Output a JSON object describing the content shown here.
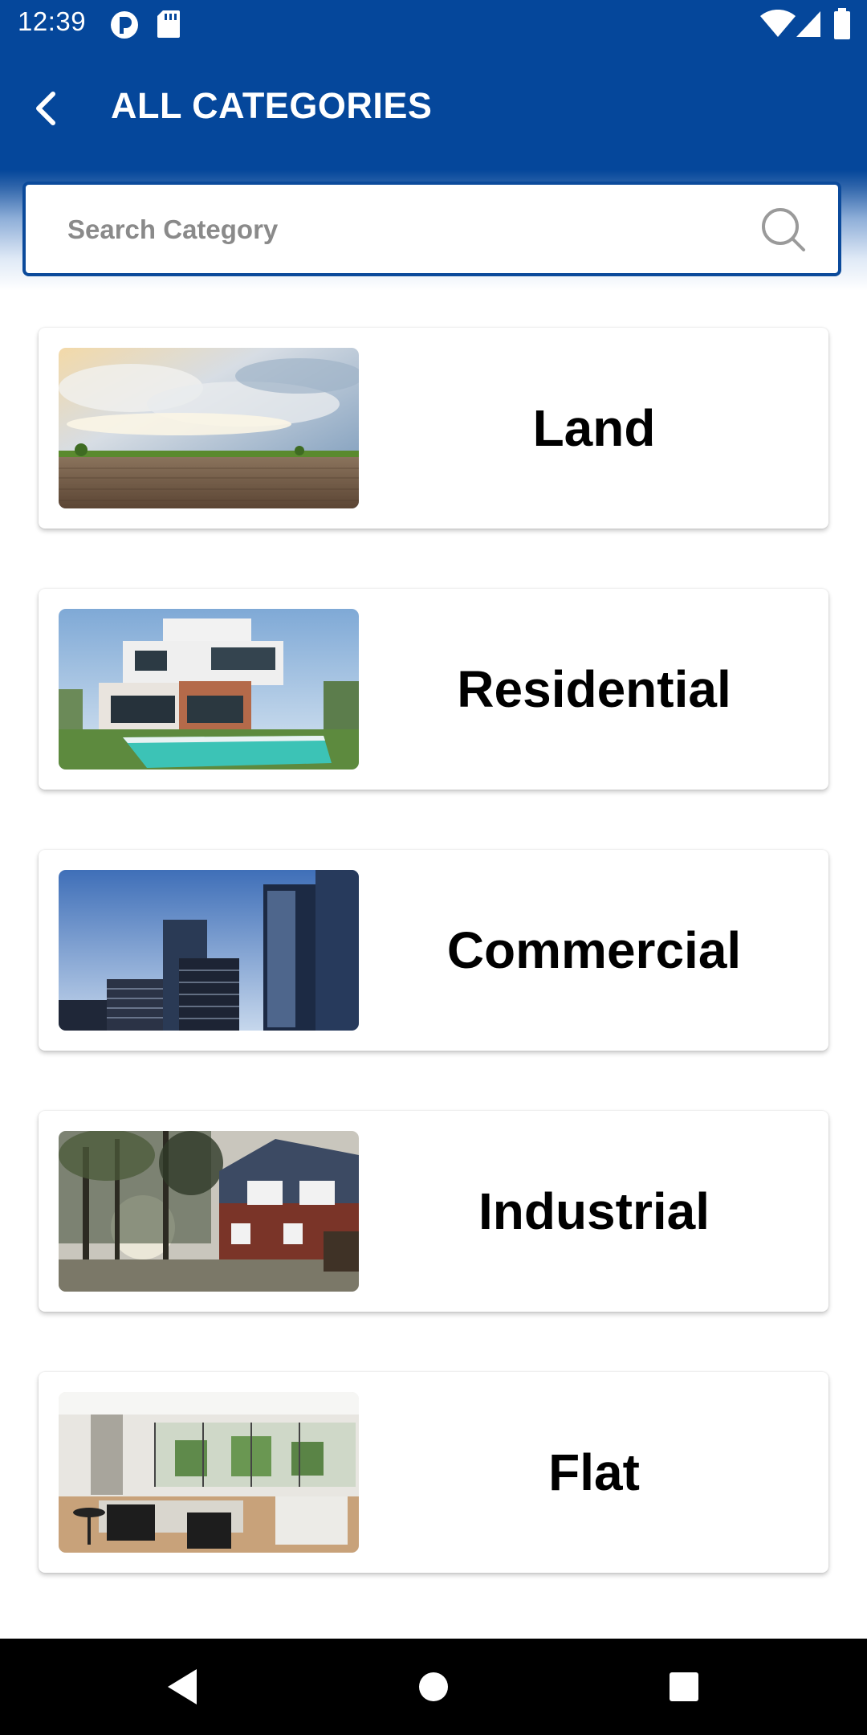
{
  "status_bar": {
    "time": "12:39",
    "icons": [
      "tracker-icon",
      "sd-card-icon",
      "wifi-icon",
      "cell-signal-icon",
      "battery-icon"
    ]
  },
  "app_bar": {
    "back_icon": "chevron-left-icon",
    "title": "ALL CATEGORIES",
    "background_color": "#05479b"
  },
  "search": {
    "placeholder": "Search Category",
    "value": "",
    "icon": "search-icon",
    "border_color": "#0b4a9b"
  },
  "categories": [
    {
      "label": "Land",
      "image": "farmland-photo"
    },
    {
      "label": "Residential",
      "image": "modern-villa-photo"
    },
    {
      "label": "Commercial",
      "image": "skyscrapers-photo"
    },
    {
      "label": "Industrial",
      "image": "brick-house-photo"
    },
    {
      "label": "Flat",
      "image": "living-room-photo"
    }
  ],
  "nav_bar": {
    "icons": [
      "back-triangle-icon",
      "home-circle-icon",
      "recents-square-icon"
    ]
  }
}
